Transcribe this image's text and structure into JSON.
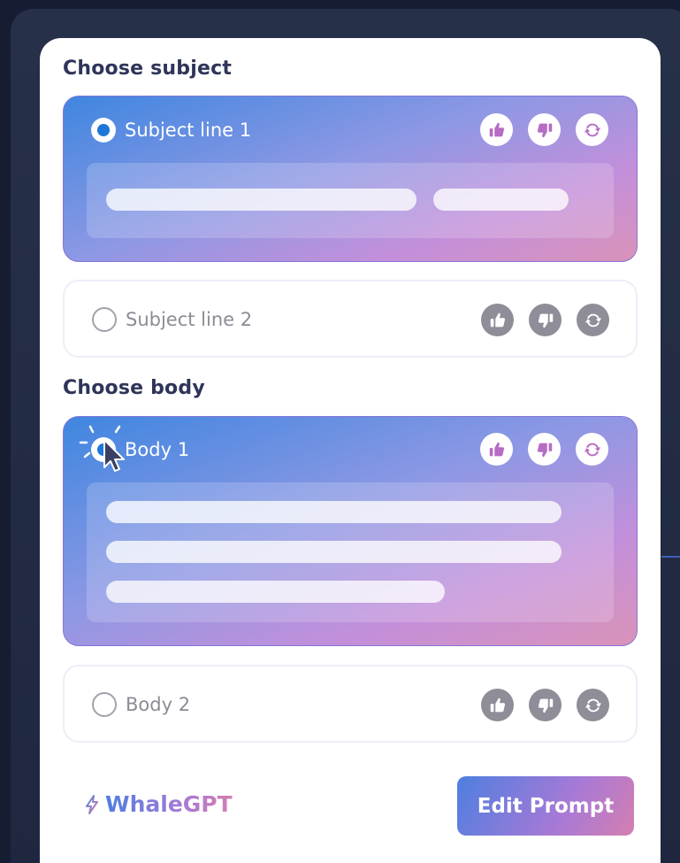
{
  "subject_section": {
    "title": "Choose subject",
    "options": [
      {
        "label": "Subject line 1",
        "selected": true
      },
      {
        "label": "Subject line 2",
        "selected": false
      }
    ]
  },
  "body_section": {
    "title": "Choose body",
    "options": [
      {
        "label": "Body 1",
        "selected": true
      },
      {
        "label": "Body 2",
        "selected": false
      }
    ]
  },
  "icons": {
    "like": "thumbs-up-icon",
    "dislike": "thumbs-down-icon",
    "regenerate": "refresh-icon",
    "brand": "lightning-icon",
    "pointer": "mouse-pointer-icon"
  },
  "footer": {
    "brand_name": "WhaleGPT",
    "edit_button_label": "Edit Prompt"
  },
  "colors": {
    "radio_active": "#1d78d8",
    "selected_gradient": [
      "#3f86e0",
      "#c48fda",
      "#d993b8"
    ],
    "brand_gradient": [
      "#4d7fe0",
      "#a779d6",
      "#d47fb0"
    ],
    "title_text": "#2f3559"
  }
}
